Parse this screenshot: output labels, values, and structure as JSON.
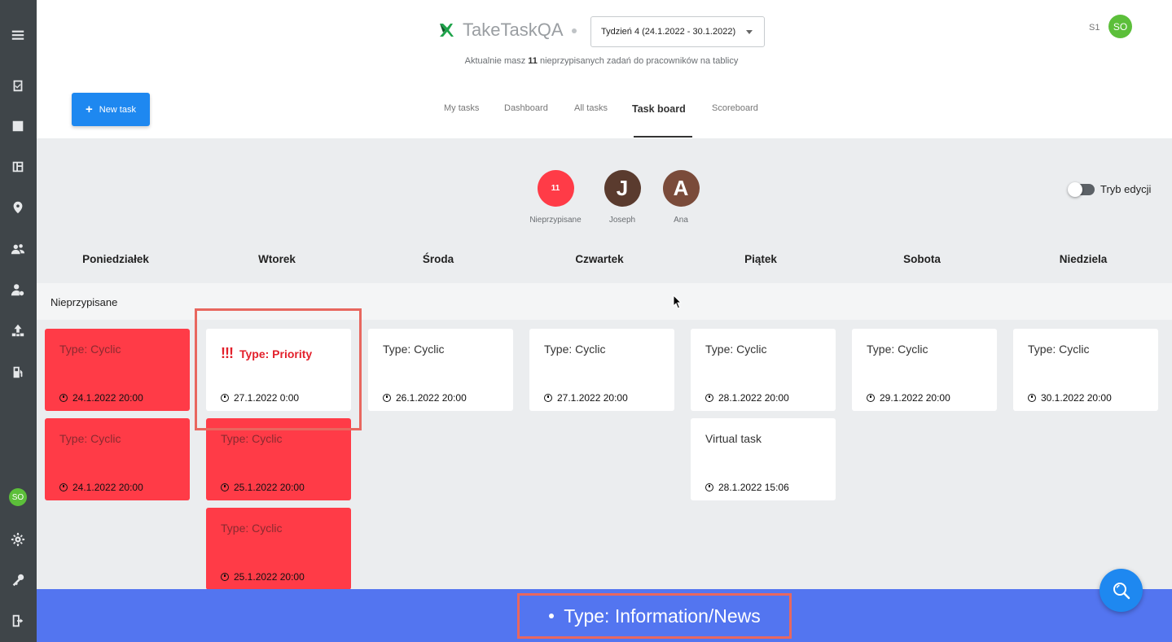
{
  "app": {
    "name": "TakeTaskQA"
  },
  "week_select": {
    "value": "Tydzień 4 (24.1.2022 - 30.1.2022)"
  },
  "subtitle": {
    "prefix": "Aktualnie masz",
    "count": "11",
    "suffix": "nieprzypisanych zadań do pracowników na tablicy"
  },
  "user": {
    "tenant": "S1",
    "initials": "SO"
  },
  "new_task": {
    "label": "New task"
  },
  "nav": [
    "My tasks",
    "Dashboard",
    "All tasks",
    "Task board",
    "Scoreboard"
  ],
  "people": [
    {
      "initial": "11",
      "name": "Nieprzypisane",
      "color": "#ff3b47"
    },
    {
      "initial": "J",
      "name": "Joseph",
      "color": "#5a3b2e"
    },
    {
      "initial": "A",
      "name": "Ana",
      "color": "#7a4b3a"
    }
  ],
  "edit_mode": {
    "label": "Tryb edycji"
  },
  "days": [
    "Poniedziałek",
    "Wtorek",
    "Środa",
    "Czwartek",
    "Piątek",
    "Sobota",
    "Niedziela"
  ],
  "row_label": "Nieprzypisane",
  "cards": [
    {
      "title": "Type: Cyclic",
      "date": "24.1.2022 20:00"
    },
    {
      "title": "Type: Cyclic",
      "date": "24.1.2022 20:00"
    },
    {
      "title": "Type: Priority",
      "date": "27.1.2022 0:00",
      "marker": "!!!"
    },
    {
      "title": "Type: Cyclic",
      "date": "25.1.2022 20:00"
    },
    {
      "title": "Type: Cyclic",
      "date": "25.1.2022 20:00"
    },
    {
      "title": "Type: Cyclic",
      "date": "26.1.2022 20:00"
    },
    {
      "title": "Type: Cyclic",
      "date": "27.1.2022 20:00"
    },
    {
      "title": "Type: Cyclic",
      "date": "28.1.2022 20:00"
    },
    {
      "title": "Virtual task",
      "date": "28.1.2022 15:06"
    },
    {
      "title": "Type: Cyclic",
      "date": "29.1.2022 20:00"
    },
    {
      "title": "Type: Cyclic",
      "date": "30.1.2022 20:00"
    }
  ],
  "footer": {
    "text": "Type: Information/News"
  },
  "colors": {
    "sidebar": "#3f4549",
    "primary": "#1e88f0",
    "danger": "#ff3b47",
    "footer": "#5375f0",
    "avatar": "#5cbf3a"
  },
  "icons": [
    "menu-icon",
    "task-check-icon",
    "table-icon",
    "layout-icon",
    "location-icon",
    "users-icon",
    "user-settings-icon",
    "hierarchy-icon",
    "fuel-icon",
    "gear-icon",
    "key-icon",
    "logout-icon",
    "search-icon",
    "clock-icon"
  ]
}
